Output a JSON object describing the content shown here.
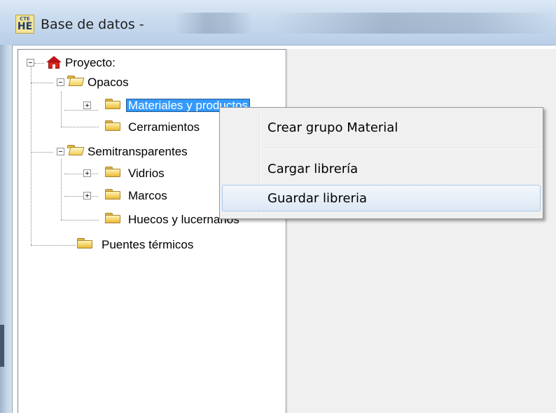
{
  "window": {
    "title": "Base de datos -",
    "icon_top": "CTE",
    "icon_bottom": "HE"
  },
  "tree": {
    "root": "Proyecto:",
    "opacos": "Opacos",
    "materiales": "Materiales y productos",
    "cerramientos": "Cerramientos",
    "semitransparentes": "Semitransparentes",
    "vidrios": "Vidrios",
    "marcos": "Marcos",
    "huecos": "Huecos y lucernarios",
    "puentes": "Puentes térmicos"
  },
  "context_menu": {
    "items": [
      "Crear grupo Material",
      "Cargar librería",
      "Guardar libreria"
    ],
    "hovered": "Guardar libreria"
  },
  "colors": {
    "selection": "#3399ff",
    "menu_bg": "#f0f0f0",
    "hover_border": "#a8c8ea"
  }
}
